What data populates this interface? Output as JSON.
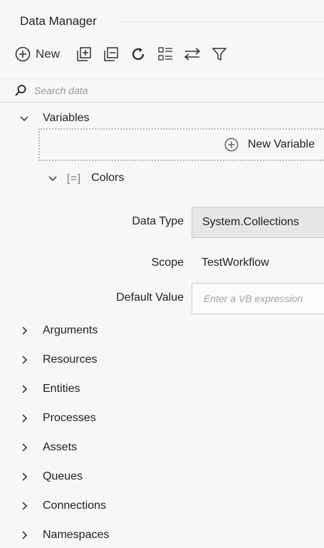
{
  "panel": {
    "title": "Data Manager"
  },
  "toolbar": {
    "new_label": "New",
    "icons": [
      "add-icon",
      "expand-all-icon",
      "collapse-all-icon",
      "refresh-icon",
      "sort-icon",
      "swap-icon",
      "filter-icon"
    ]
  },
  "search": {
    "placeholder": "Search data"
  },
  "variables": {
    "label": "Variables",
    "new_variable_label": "New Variable",
    "items": [
      {
        "name": "Colors",
        "bracket": "[=]",
        "properties": {
          "data_type_label": "Data Type",
          "data_type_value": "System.Collections",
          "scope_label": "Scope",
          "scope_value": "TestWorkflow",
          "default_value_label": "Default Value",
          "default_value_placeholder": "Enter a VB expression"
        }
      }
    ]
  },
  "sections": [
    {
      "label": "Arguments"
    },
    {
      "label": "Resources"
    },
    {
      "label": "Entities"
    },
    {
      "label": "Processes"
    },
    {
      "label": "Assets"
    },
    {
      "label": "Queues"
    },
    {
      "label": "Connections"
    },
    {
      "label": "Namespaces"
    }
  ]
}
